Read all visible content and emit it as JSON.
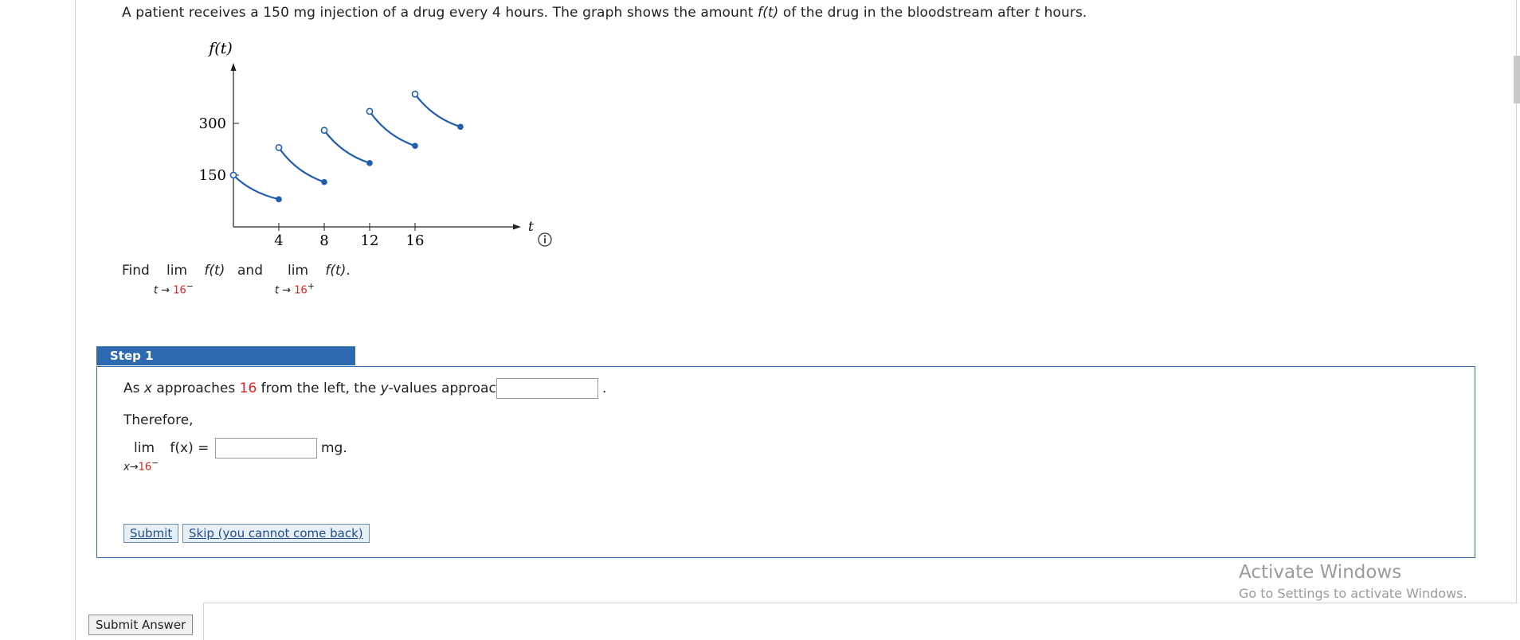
{
  "problem": {
    "part1": "A patient receives a 150 mg injection of a drug every 4 hours. The graph shows the amount ",
    "func": "f(t)",
    "part2": " of the drug in the bloodstream after ",
    "var": "t",
    "part3": " hours."
  },
  "graph": {
    "y_axis_label": "f(t)",
    "x_axis_label": "t",
    "y_ticks": [
      "300",
      "150"
    ],
    "x_ticks": [
      "4",
      "8",
      "12",
      "16"
    ],
    "info_icon": "info-icon"
  },
  "chart_data": {
    "type": "line",
    "title": "",
    "xlabel": "t",
    "ylabel": "f(t)",
    "x_ticks": [
      4,
      8,
      12,
      16
    ],
    "y_ticks": [
      150,
      300
    ],
    "xlim": [
      0,
      20
    ],
    "ylim": [
      0,
      380
    ],
    "series": [
      {
        "x": [
          0,
          4
        ],
        "y": [
          150,
          80
        ],
        "start": "open",
        "end": "closed"
      },
      {
        "x": [
          4,
          8
        ],
        "y": [
          230,
          130
        ],
        "start": "open",
        "end": "closed"
      },
      {
        "x": [
          8,
          12
        ],
        "y": [
          280,
          185
        ],
        "start": "open",
        "end": "closed"
      },
      {
        "x": [
          12,
          16
        ],
        "y": [
          335,
          235
        ],
        "start": "open",
        "end": "closed"
      },
      {
        "x": [
          16,
          20
        ],
        "y": [
          385,
          290
        ],
        "start": "open",
        "end": "closed"
      }
    ]
  },
  "find": {
    "find_label": "Find",
    "lim": "lim",
    "func": "f(t)",
    "and_label": "and",
    "sub_var": "t →",
    "sub_val": "16",
    "left_sign": "−",
    "right_sign": "+",
    "end": "."
  },
  "step": {
    "tab_label": "Step 1",
    "sentence": {
      "p1": "As ",
      "x": "x",
      "p2": " approaches ",
      "val": "16",
      "p3": " from the left, the ",
      "y": "y",
      "p4": "-values approach",
      "end": "."
    },
    "therefore": "Therefore,",
    "lim": "lim",
    "lim_sub_var": "x→",
    "lim_sub_val": "16",
    "lim_sub_sign": "−",
    "func": "f(x) =",
    "unit": "mg.",
    "input1_value": "",
    "input2_value": "",
    "submit_label": "Submit",
    "skip_label": "Skip (you cannot come back)"
  },
  "submit_answer_label": "Submit Answer",
  "watermark": {
    "line1": "Activate Windows",
    "line2": "Go to Settings to activate Windows."
  },
  "colors": {
    "curve": "#1f5fad",
    "accent": "#2d6aaf",
    "red": "#e8211b"
  }
}
